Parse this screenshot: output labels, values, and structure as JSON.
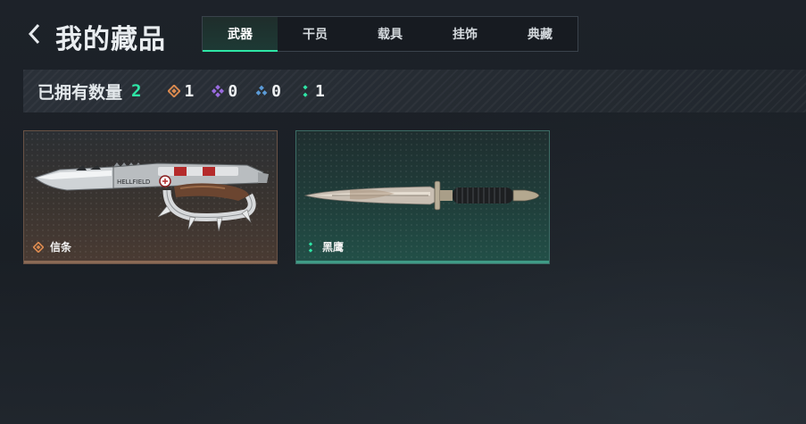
{
  "header": {
    "title": "我的藏品",
    "tabs": [
      {
        "label": "武器",
        "active": true
      },
      {
        "label": "干员",
        "active": false
      },
      {
        "label": "载具",
        "active": false
      },
      {
        "label": "挂饰",
        "active": false
      },
      {
        "label": "典藏",
        "active": false
      }
    ]
  },
  "stats": {
    "owned_label": "已拥有数量",
    "owned_count": "2",
    "rarities": [
      {
        "icon": "orange-diamond-icon",
        "color": "#d9894f",
        "count": "1"
      },
      {
        "icon": "purple-diamond-icon",
        "color": "#9a6be0",
        "count": "0"
      },
      {
        "icon": "blue-triangle-icon",
        "color": "#5b9bd8",
        "count": "0"
      },
      {
        "icon": "green-dots-icon",
        "color": "#2ee6a6",
        "count": "1"
      }
    ]
  },
  "items": [
    {
      "name": "信条",
      "rarity_icon": "orange-diamond-icon",
      "rarity_color": "#d9894f",
      "weapon": "knuckle-knife"
    },
    {
      "name": "黑鹰",
      "rarity_icon": "green-dots-icon",
      "rarity_color": "#2ee6a6",
      "weapon": "dagger"
    }
  ],
  "colors": {
    "accent": "#2ee6a6",
    "background": "#1b2026"
  }
}
